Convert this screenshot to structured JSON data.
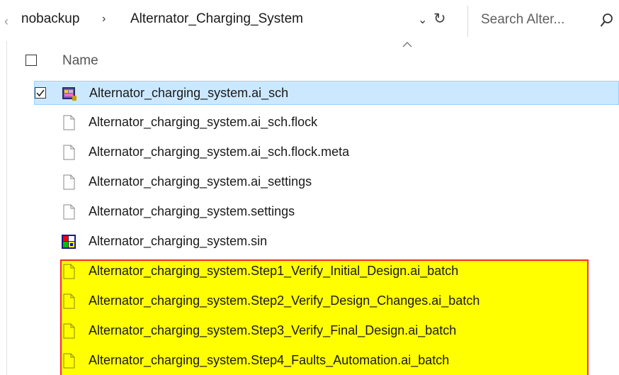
{
  "address": {
    "path": [
      "nobackup",
      "Alternator_Charging_System"
    ],
    "separator": "›",
    "dropdown_glyph": "⌄",
    "refresh_glyph": "↻"
  },
  "search": {
    "placeholder": "Search Alter...",
    "icon": "search-icon"
  },
  "columns": {
    "name_label": "Name",
    "sort_glyph": "^"
  },
  "files": [
    {
      "name": "Alternator_charging_system.ai_sch",
      "icon": "schematic-app-icon",
      "selected": true,
      "checked": true
    },
    {
      "name": "Alternator_charging_system.ai_sch.flock",
      "icon": "blank-file-icon"
    },
    {
      "name": "Alternator_charging_system.ai_sch.flock.meta",
      "icon": "blank-file-icon"
    },
    {
      "name": "Alternator_charging_system.ai_settings",
      "icon": "blank-file-icon"
    },
    {
      "name": "Alternator_charging_system.settings",
      "icon": "blank-file-icon"
    },
    {
      "name": "Alternator_charging_system.sin",
      "icon": "sin-app-icon"
    },
    {
      "name": "Alternator_charging_system.Step1_Verify_Initial_Design.ai_batch",
      "icon": "blank-file-icon",
      "highlighted": true
    },
    {
      "name": "Alternator_charging_system.Step2_Verify_Design_Changes.ai_batch",
      "icon": "blank-file-icon",
      "highlighted": true
    },
    {
      "name": "Alternator_charging_system.Step3_Verify_Final_Design.ai_batch",
      "icon": "blank-file-icon",
      "highlighted": true
    },
    {
      "name": "Alternator_charging_system.Step4_Faults_Automation.ai_batch",
      "icon": "blank-file-icon",
      "highlighted": true
    }
  ],
  "colors": {
    "selection_bg": "#cce8ff",
    "selection_border": "#99d1ff",
    "highlight_fill": "#ffff00",
    "highlight_border": "#ff2a2a"
  }
}
